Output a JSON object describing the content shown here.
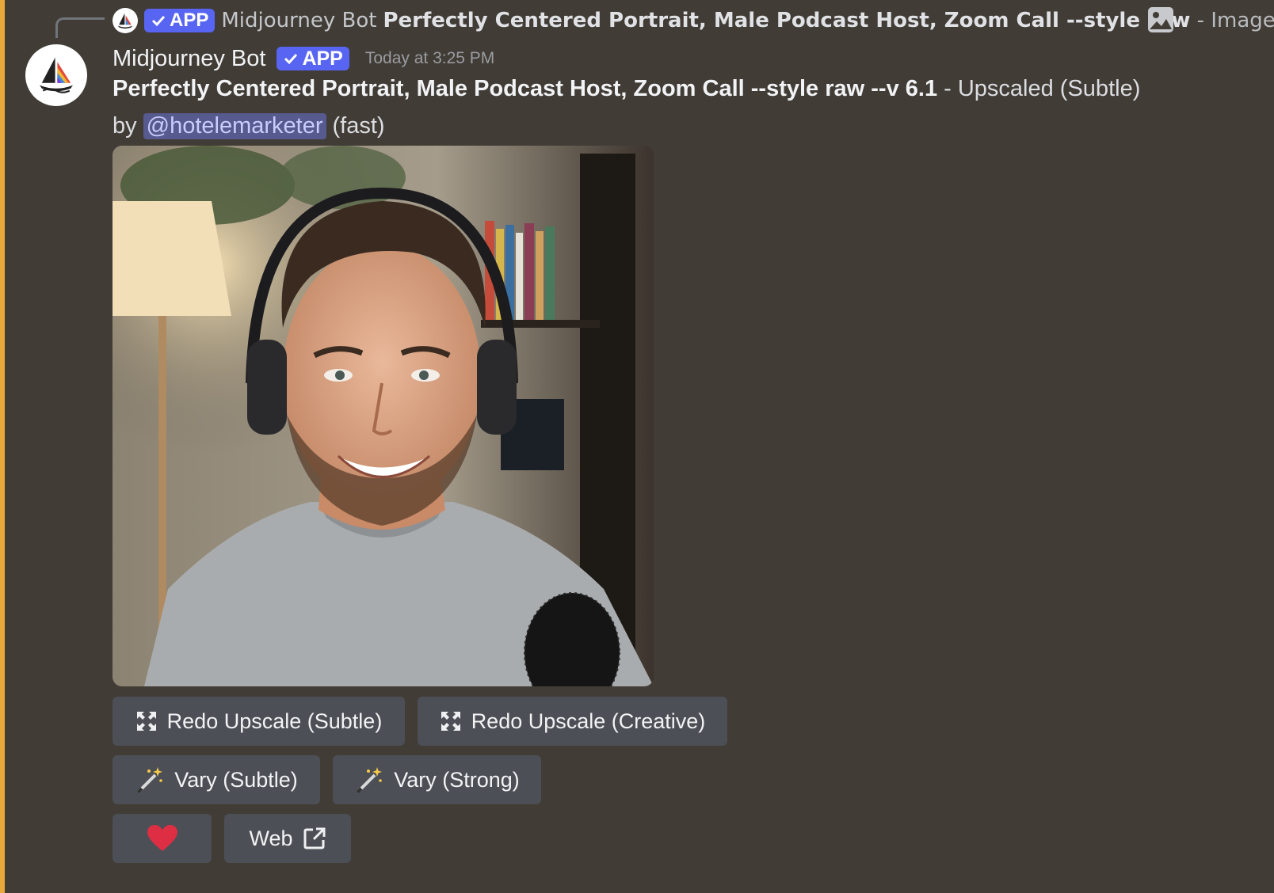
{
  "reply": {
    "badge": "APP",
    "author": "Midjourney Bot",
    "prompt_bold": "Perfectly Centered Portrait, Male Podcast Host, Zoom Call --style raw",
    "suffix": " - Image ..."
  },
  "message": {
    "author": "Midjourney Bot",
    "badge": "APP",
    "timestamp": "Today at 3:25 PM",
    "prompt_bold": "Perfectly Centered Portrait, Male Podcast Host, Zoom Call --style raw --v 6.1",
    "suffix": " - Upscaled (Subtle)",
    "by_label": "by",
    "mention": "@hotelemarketer",
    "mode": "(fast)"
  },
  "buttons": {
    "redo_subtle": "Redo Upscale (Subtle)",
    "redo_creative": "Redo Upscale (Creative)",
    "vary_subtle": "Vary (Subtle)",
    "vary_strong": "Vary (Strong)",
    "web": "Web"
  },
  "colors": {
    "background": "#413c36",
    "accent_bar": "#e8a93b",
    "app_badge": "#5865f2",
    "button_bg": "#4c4f55",
    "mention_bg": "#565a8f",
    "heart": "#dd2e44"
  },
  "icons": {
    "reply_image": "image-icon",
    "upscale": "expand-arrows-icon",
    "vary": "magic-wand-icon",
    "favorite": "heart-icon",
    "external": "external-link-icon"
  }
}
